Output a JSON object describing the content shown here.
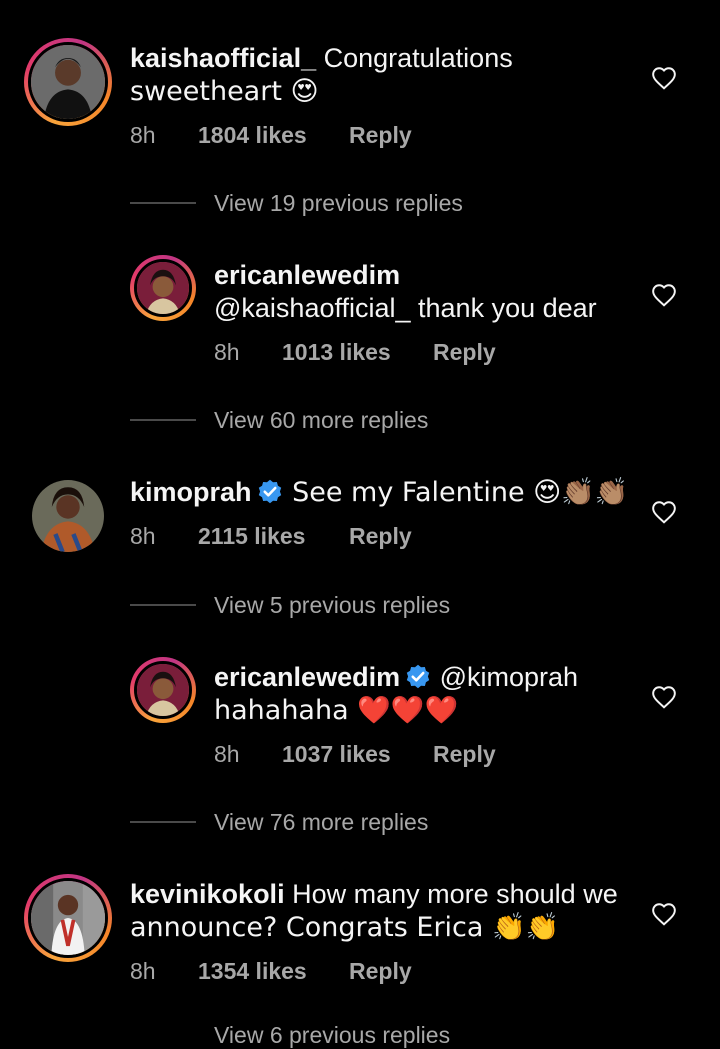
{
  "comments": [
    {
      "username": "kaishaofficial_",
      "text_line1": " Congratulations",
      "text_line2": "sweetheart 😍",
      "time": "8h",
      "likes": "1804 likes",
      "reply": "Reply",
      "view_replies": "View 19 previous replies"
    },
    {
      "username": "ericanlewedim",
      "text_line1": "@kaishaofficial_ thank you dear",
      "time": "8h",
      "likes": "1013 likes",
      "reply": "Reply",
      "view_replies": "View 60 more replies"
    },
    {
      "username": "kimoprah",
      "text_line1": " See my Falentine 😍👏🏽👏🏽",
      "time": "8h",
      "likes": "2115 likes",
      "reply": "Reply",
      "view_replies": "View 5 previous replies"
    },
    {
      "username": "ericanlewedim",
      "text_line1": " @kimoprah",
      "text_line2": "hahahaha ❤️❤️❤️",
      "time": "8h",
      "likes": "1037 likes",
      "reply": "Reply",
      "view_replies": "View 76 more replies"
    },
    {
      "username": "kevinikokoli",
      "text_line1": " How many more should we",
      "text_line2": "announce? Congrats Erica 👏👏",
      "time": "8h",
      "likes": "1354 likes",
      "reply": "Reply",
      "view_replies": "View 6 previous replies"
    }
  ],
  "colors": {
    "background": "#000000",
    "text": "#f5f5f5",
    "muted": "#a8a8a8",
    "verified": "#3897f0",
    "story_ring": "#e23a6a"
  },
  "icons": [
    "heart-outline-icon",
    "verified-badge-icon"
  ]
}
